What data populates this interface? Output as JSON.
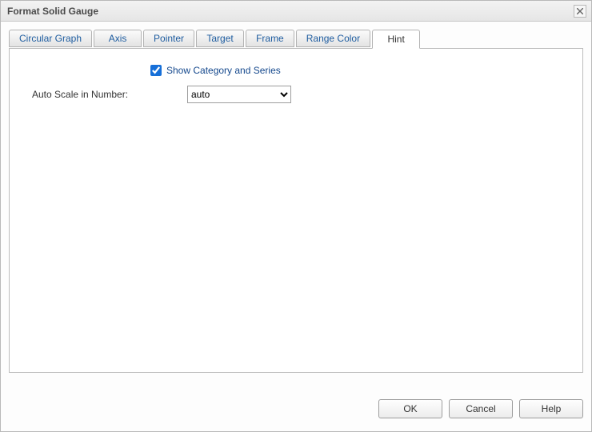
{
  "dialog": {
    "title": "Format Solid Gauge"
  },
  "tabs": [
    {
      "label": "Circular Graph"
    },
    {
      "label": "Axis"
    },
    {
      "label": "Pointer"
    },
    {
      "label": "Target"
    },
    {
      "label": "Frame"
    },
    {
      "label": "Range Color"
    },
    {
      "label": "Hint"
    }
  ],
  "hint_panel": {
    "show_category_label": "Show Category and Series",
    "show_category_checked": true,
    "auto_scale_label": "Auto Scale in Number:",
    "auto_scale_value": "auto",
    "auto_scale_options": [
      "auto"
    ]
  },
  "buttons": {
    "ok": "OK",
    "cancel": "Cancel",
    "help": "Help"
  }
}
